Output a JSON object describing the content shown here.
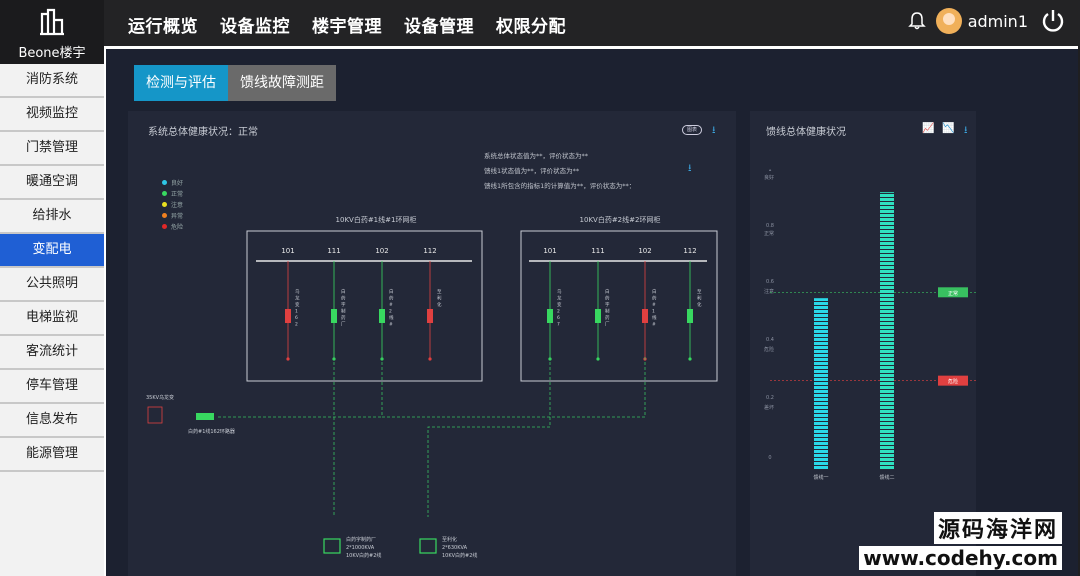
{
  "app": {
    "brand": "Beone楼宇",
    "user": "admin1"
  },
  "nav": [
    "运行概览",
    "设备监控",
    "楼宇管理",
    "设备管理",
    "权限分配"
  ],
  "sidebar": [
    "消防系统",
    "视频监控",
    "门禁管理",
    "暖通空调",
    "给排水",
    "变配电",
    "公共照明",
    "电梯监视",
    "客流统计",
    "停车管理",
    "信息发布",
    "能源管理"
  ],
  "sidebar_active": 5,
  "tabs": [
    "检测与评估",
    "馈线故障测距"
  ],
  "left": {
    "title": "系统总体健康状况：正常",
    "icon_btn": "图表",
    "legend": [
      {
        "label": "良好",
        "color": "#2ec6e6"
      },
      {
        "label": "正常",
        "color": "#38d860"
      },
      {
        "label": "注意",
        "color": "#e8e020"
      },
      {
        "label": "异常",
        "color": "#f08020"
      },
      {
        "label": "危险",
        "color": "#e02828"
      }
    ],
    "notes": [
      "系统总体状态值为**，评价状态为**",
      "馈线1状态值为**，评价状态为**",
      "馈线1所包含的指标1的计算值为**，评价状态为**："
    ],
    "cabinet1": {
      "title": "10KV白药#1线#1环网柜",
      "cols": [
        "101",
        "111",
        "102",
        "112"
      ],
      "labels": [
        "乌龙变162开关",
        "白药字制药厂",
        "白药#2线#1环网柜102",
        "至利化"
      ]
    },
    "cabinet2": {
      "title": "10KV白药#2线#2环网柜",
      "cols": [
        "101",
        "111",
        "102",
        "112"
      ],
      "labels": [
        "乌龙变267开关",
        "白药字制药厂",
        "白药#1线#1环网柜102",
        "至利化"
      ]
    },
    "station": {
      "title": "35KV乌龙变",
      "device": "白药#1线162环路器"
    },
    "bottom1": [
      "白药字制药厂",
      "2*1000KVA",
      "10KV白药#2线"
    ],
    "bottom2": [
      "至利化",
      "2*630KVA",
      "10KV白药#2线"
    ]
  },
  "right": {
    "title": "馈线总体健康状况"
  },
  "chart_data": {
    "type": "bar",
    "categories": [
      "馈线一",
      "馈线二"
    ],
    "values": [
      0.58,
      0.94
    ],
    "y_ticks": [
      "1",
      "0.8",
      "0.6",
      "0.4",
      "0.2",
      "0"
    ],
    "band_labels": [
      "良好",
      "正常",
      "注意",
      "危险",
      "差坏"
    ],
    "thresholds": [
      {
        "label": "正常",
        "value": 0.6,
        "color": "#38c060"
      },
      {
        "label": "危险",
        "value": 0.3,
        "color": "#e04040"
      }
    ],
    "colors": {
      "bar1": "#2ad8e8",
      "bar2": "#30e0c0"
    }
  },
  "watermark": {
    "line1": "源码海洋网",
    "line2": "www.codehy.com"
  }
}
